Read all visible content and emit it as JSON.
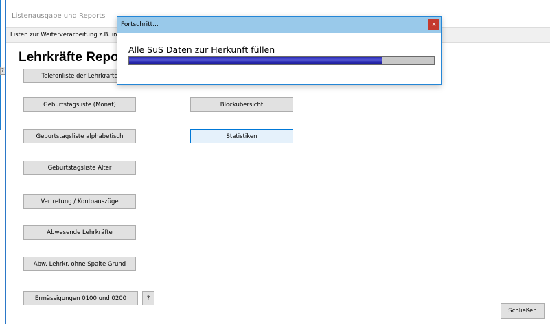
{
  "window": {
    "title": "Listenausgabe und Reports",
    "tab_label": "Listen zur Weiterverarbeitung z.B. in",
    "heading": "Lehrkräfte Repor"
  },
  "buttons": {
    "telefonliste": "Telefonliste der Lehrkräfte",
    "geburtstag_monat": "Geburtstagsliste (Monat)",
    "geburtstag_alpha": "Geburtstagsliste alphabetisch",
    "geburtstag_alter": "Geburtstagsliste Alter",
    "vertretung": "Vertretung / Kontoauszüge",
    "abwesende": "Abwesende Lehrkräfte",
    "abw_ohne_grund": "Abw. Lehrkr. ohne Spalte Grund",
    "ermaessigungen": "Ermässigungen 0100 und 0200",
    "help": "?",
    "blockuebersicht": "Blockübersicht",
    "statistiken": "Statistiken",
    "schliessen": "Schließen"
  },
  "background": {
    "side_tab": "?"
  },
  "dialog": {
    "title": "Fortschritt...",
    "close_glyph": "x",
    "message": "Alle SuS Daten zur Herkunft füllen",
    "progress_fraction": 0.828
  },
  "colors": {
    "accent": "#0078d7",
    "dialog_titlebar": "#99c9ea",
    "close_button": "#c43a2e",
    "progress_fill": "#3a3cc4"
  }
}
